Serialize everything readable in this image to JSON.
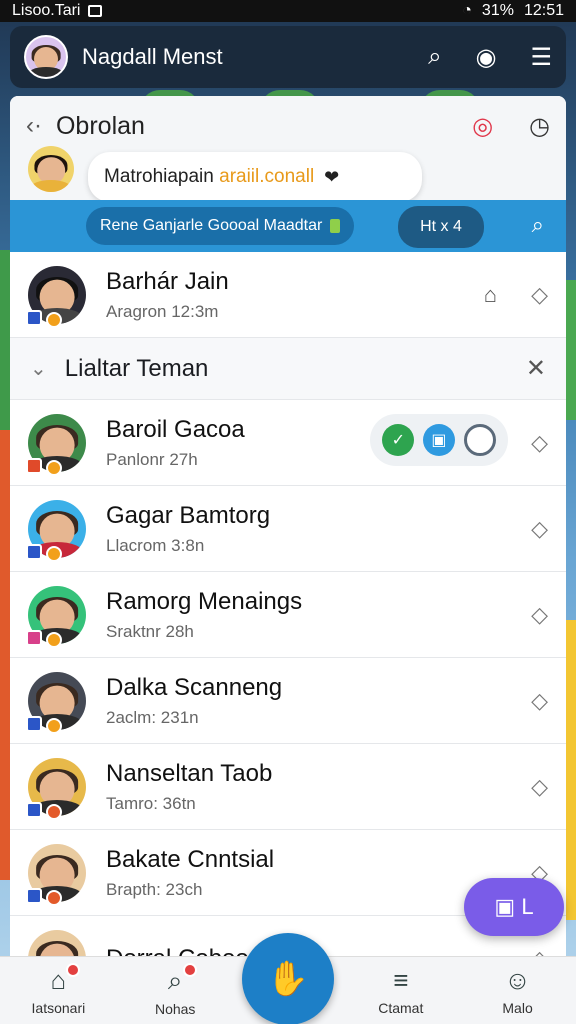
{
  "status_bar": {
    "left_text": "Lisoo.Tari",
    "battery": "31%",
    "time": "12:51"
  },
  "app_bar": {
    "title": "Nagdall Menst"
  },
  "chat": {
    "title": "Obrolan",
    "bubble_text": "Matrohiapain",
    "bubble_highlight": "araiil.conall",
    "strip_text": "Rene Ganjarle Goooal Maadtar",
    "pill_text": "Ht x 4"
  },
  "pinned": {
    "name": "Barhár Jain",
    "sub": "Aragron 12:3m"
  },
  "section": {
    "title": "Lialtar Teman"
  },
  "friends": [
    {
      "name": "Baroil Gacoa",
      "sub": "Panlonr 27h"
    },
    {
      "name": "Gagar Bamtorg",
      "sub": "Llacrom 3:8n"
    },
    {
      "name": "Ramorg Menaings",
      "sub": "Sraktnr 28h"
    },
    {
      "name": "Dalka Scanneng",
      "sub": "2aclm: 231n"
    },
    {
      "name": "Nanseltan Taob",
      "sub": "Tamro: 36tn"
    },
    {
      "name": "Bakate Cnntsial",
      "sub": "Brapth: 23ch"
    },
    {
      "name": "Dorral Coboonrm",
      "sub": ""
    }
  ],
  "fab_label": "L",
  "bottom_nav": [
    {
      "label": "Iatsonari"
    },
    {
      "label": "Nohas"
    },
    {
      "label": "Ctamat"
    },
    {
      "label": "Malo"
    }
  ],
  "colors": {
    "accent": "#2b95d6",
    "fab": "#7a5ce8",
    "center_nav": "#1d7fc7"
  }
}
